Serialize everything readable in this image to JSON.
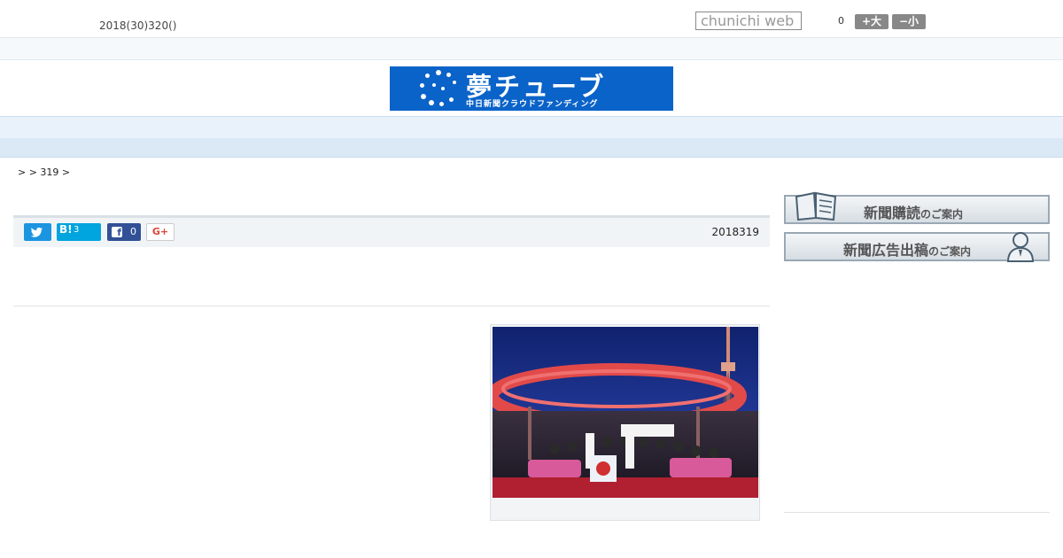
{
  "header": {
    "date": "2018(30)320()",
    "search_placeholder": "chunichi web",
    "count": "0",
    "font_up": "+大",
    "font_down": "−小"
  },
  "logo": {
    "title": "夢チューブ",
    "subtitle": "中日新聞クラウドファンディング"
  },
  "nav": {
    "items": [
      "",
      "",
      "",
      "",
      "",
      "",
      "",
      "",
      ""
    ]
  },
  "breadcrumb": ">  > 319 >",
  "share": {
    "twitter_icon": "twitter-bird",
    "hatena_label": "B!",
    "hatena_count": "3",
    "facebook_count": "0",
    "gplus_label": "G+"
  },
  "article": {
    "date": "2018319"
  },
  "sidebar": {
    "banner1_main": "新聞購読",
    "banner1_small": "のご案内",
    "banner2_main": "新聞広告出稿",
    "banner2_small": "のご案内"
  },
  "colors": {
    "logo_bg": "#0a63c8",
    "nav_bg": "#e9f2fb",
    "twitter": "#1b95e0",
    "hatena": "#00a4de",
    "facebook": "#315096"
  }
}
